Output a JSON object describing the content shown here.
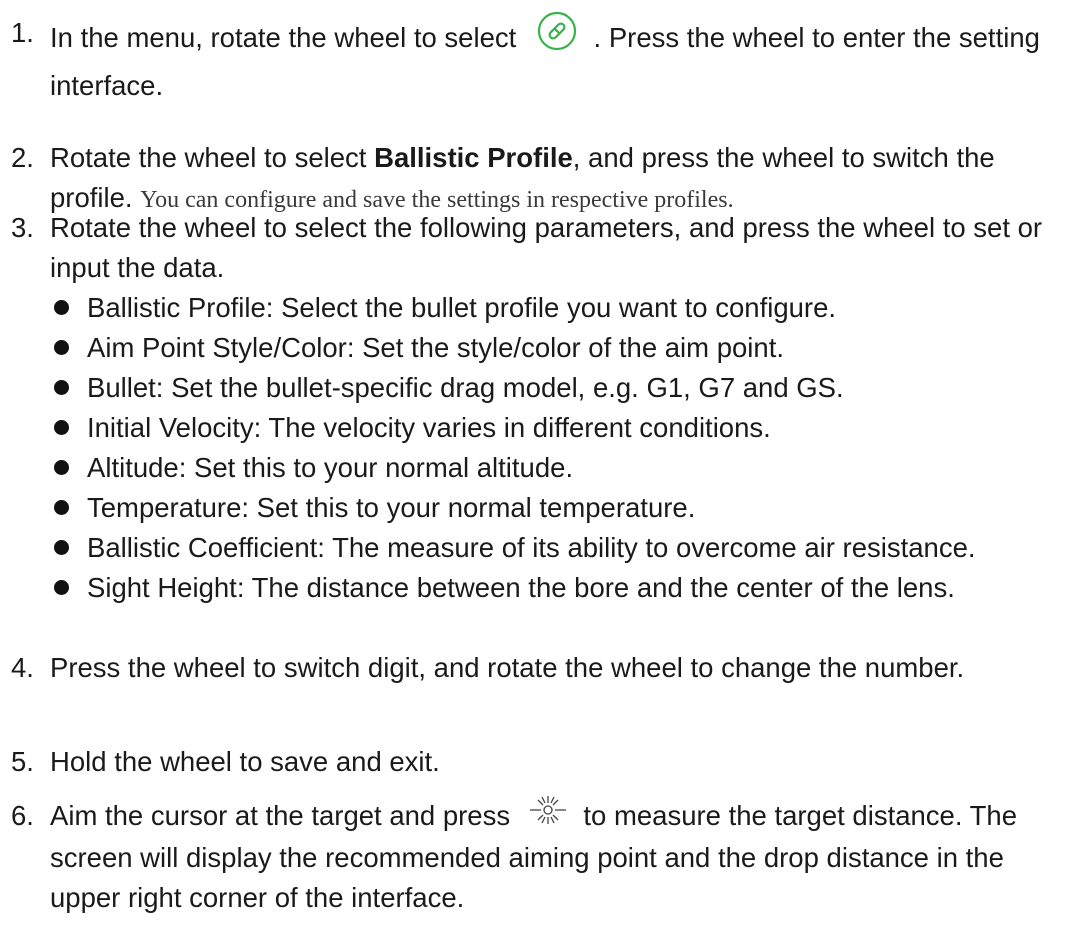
{
  "steps": [
    {
      "num": "1.",
      "before_icon": "In the menu, rotate the wheel to select",
      "icon": "ballistic-calibration-icon",
      "after_icon": ". Press the wheel to enter the setting interface."
    },
    {
      "num": "2.",
      "text_a": "Rotate the wheel to select ",
      "bold": "Ballistic Profile",
      "text_b": ", and press the wheel to switch the profile.",
      "note": "You can configure and save the settings in respective profiles."
    },
    {
      "num": "3.",
      "text": "Rotate the wheel to select the following parameters, and press the wheel to set or input the data.",
      "bullets": [
        "Ballistic Profile: Select the bullet profile you want to configure.",
        "Aim Point Style/Color: Set the style/color of the aim point.",
        "Bullet: Set the bullet-specific drag model, e.g. G1, G7 and GS.",
        "Initial Velocity: The velocity varies in different conditions.",
        "Altitude: Set this to your normal altitude.",
        "Temperature: Set this to your normal temperature.",
        "Ballistic Coefficient: The measure of its ability to overcome air resistance.",
        "Sight Height: The distance between the bore and the center of the lens."
      ]
    },
    {
      "num": "4.",
      "text": "Press the wheel to switch digit, and rotate the wheel to change the number."
    },
    {
      "num": "5.",
      "text": "Hold the wheel to save and exit."
    },
    {
      "num": "6.",
      "before_icon": "Aim the cursor at the target and press",
      "icon": "laser-rangefinder-icon",
      "after_icon": "to measure the target distance. The screen will display the recommended aiming point and the drop distance in the upper right corner of the interface."
    }
  ],
  "colors": {
    "icon_green": "#35b34a",
    "text": "#1a1a1a"
  }
}
